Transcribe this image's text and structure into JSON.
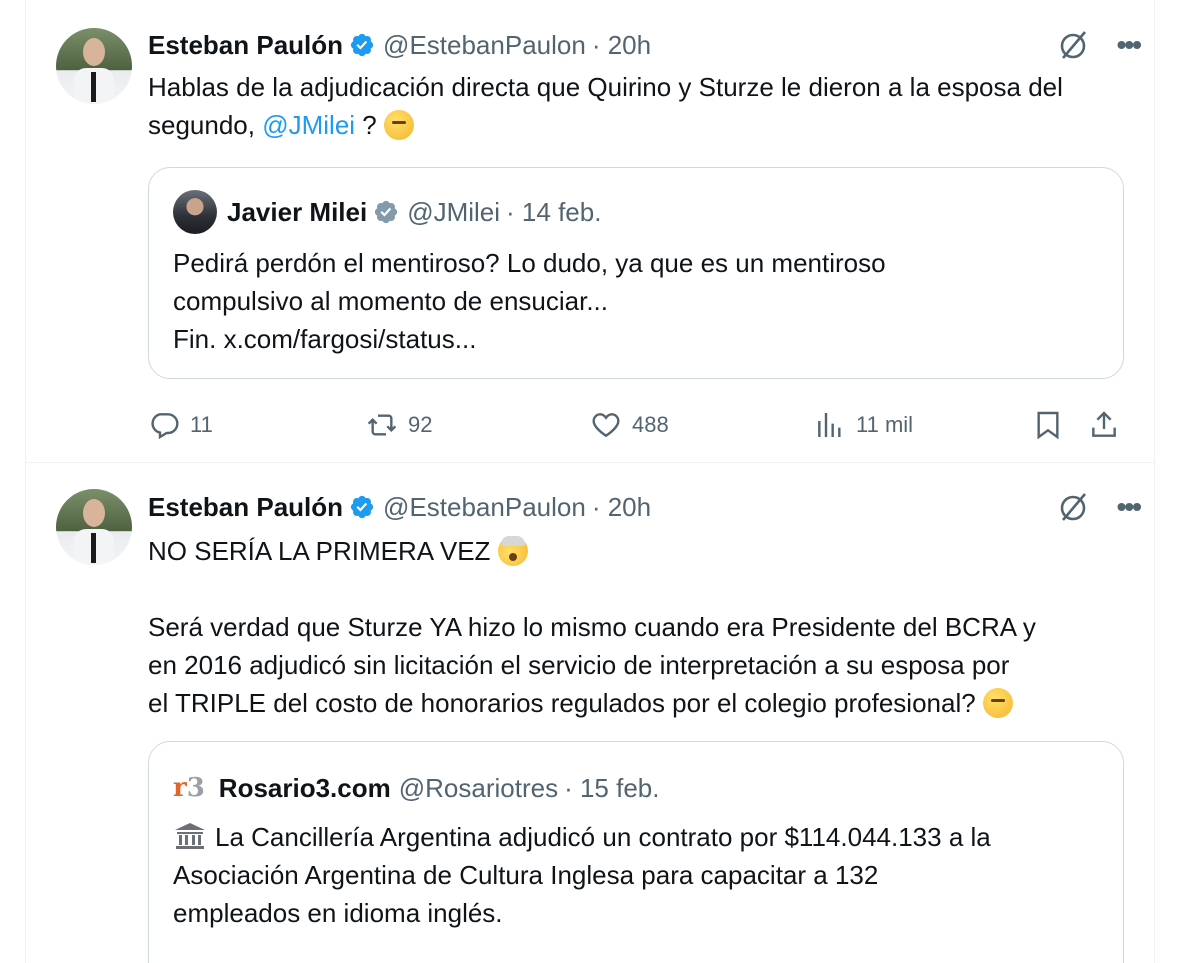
{
  "tweets": [
    {
      "author": {
        "name": "Esteban Paulón",
        "handle": "@EstebanPaulon",
        "time": "· 20h"
      },
      "text_before": "Hablas de la adjudicación directa que Quirino y Sturze le dieron a la esposa del segundo, ",
      "mention": "@JMilei",
      "text_after": " ? ",
      "quote": {
        "name": "Javier Milei",
        "handle": "@JMilei",
        "time": "· 14 feb.",
        "lines": [
          "Pedirá perdón el mentiroso? Lo dudo, ya que es un mentiroso",
          "compulsivo al momento de ensuciar...",
          "Fin. x.com/fargosi/status..."
        ]
      },
      "actions": {
        "replies": "11",
        "retweets": "92",
        "likes": "488",
        "views": "11 mil"
      }
    },
    {
      "author": {
        "name": "Esteban Paulón",
        "handle": "@EstebanPaulon",
        "time": "· 20h"
      },
      "line1": "NO SERÍA LA PRIMERA VEZ ",
      "paragraph": [
        "Será verdad que Sturze YA hizo lo mismo cuando era Presidente del BCRA y",
        "en 2016 adjudicó sin licitación el servicio de interpretación a su esposa por",
        "el TRIPLE del costo de honorarios regulados por el colegio profesional? "
      ],
      "quote": {
        "logo_r": "r",
        "logo_3": "3",
        "name": "Rosario3.com",
        "handle": "@Rosariotres",
        "time": "· 15 feb.",
        "lines": [
          "La Cancillería Argentina adjudicó un contrato por $114.044.133 a la",
          "Asociación Argentina de Cultura Inglesa para capacitar a 132",
          "empleados en idioma inglés."
        ]
      }
    }
  ],
  "icons": {
    "verified": "verified-badge-icon",
    "grok": "grok-icon",
    "more": "more-icon",
    "reply": "reply-icon",
    "retweet": "retweet-icon",
    "like": "heart-icon",
    "views": "views-icon",
    "bookmark": "bookmark-icon",
    "share": "share-icon"
  },
  "colors": {
    "accent": "#1d9bf0",
    "secondary_text": "#536471",
    "border": "#cfd9de"
  }
}
